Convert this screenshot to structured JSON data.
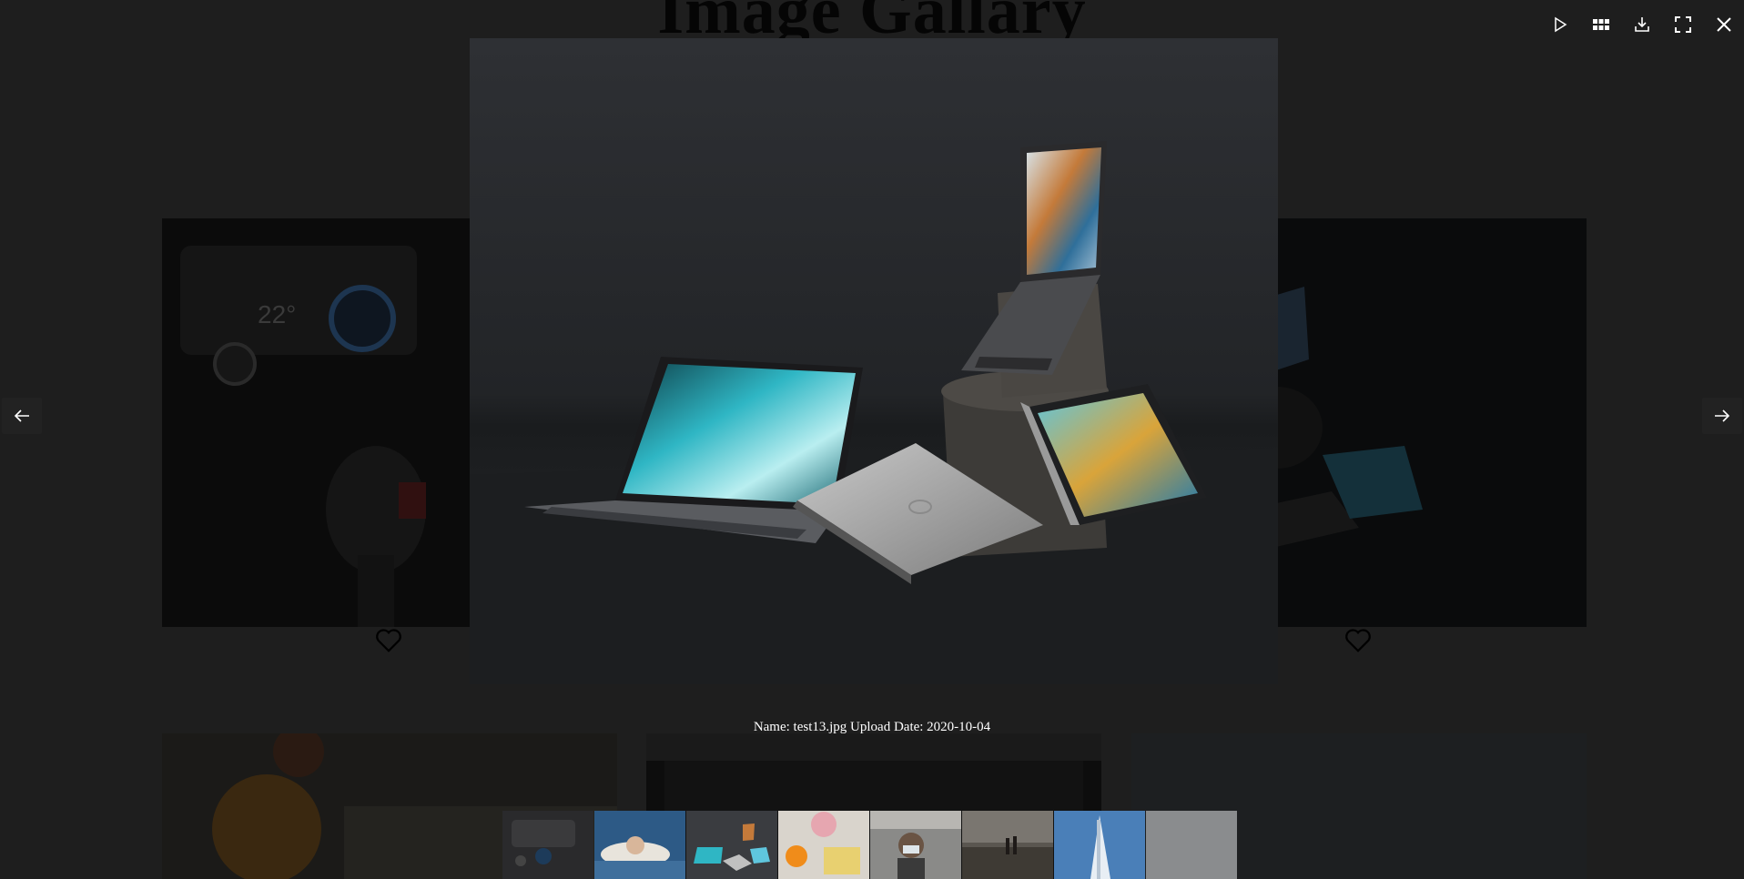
{
  "page": {
    "title": "Image Gallary"
  },
  "viewer": {
    "caption": "Name: test13.jpg Upload Date: 2020-10-04",
    "current_image": "laptops-photo"
  },
  "toolbar": {
    "items": [
      {
        "name": "play-button",
        "icon": "play-icon"
      },
      {
        "name": "thumbnails-button",
        "icon": "grid-icon"
      },
      {
        "name": "download-button",
        "icon": "download-icon"
      },
      {
        "name": "fullscreen-button",
        "icon": "fullscreen-icon"
      },
      {
        "name": "close-button",
        "icon": "close-icon"
      }
    ]
  },
  "navigation": {
    "prev_icon": "arrow-left-icon",
    "next_icon": "arrow-right-icon"
  },
  "thumbnails": [
    {
      "subject": "car-dashboard",
      "active": false
    },
    {
      "subject": "woman-hat",
      "active": false
    },
    {
      "subject": "laptops",
      "active": true
    },
    {
      "subject": "oranges-flowers",
      "active": false
    },
    {
      "subject": "man-mask",
      "active": false
    },
    {
      "subject": "beach-people",
      "active": false
    },
    {
      "subject": "building-sky",
      "active": false
    },
    {
      "subject": "gray-plain",
      "active": false
    }
  ],
  "colors": {
    "backdrop": "#1e1e1e",
    "icon": "#ffffff",
    "caption": "#ffffff"
  }
}
